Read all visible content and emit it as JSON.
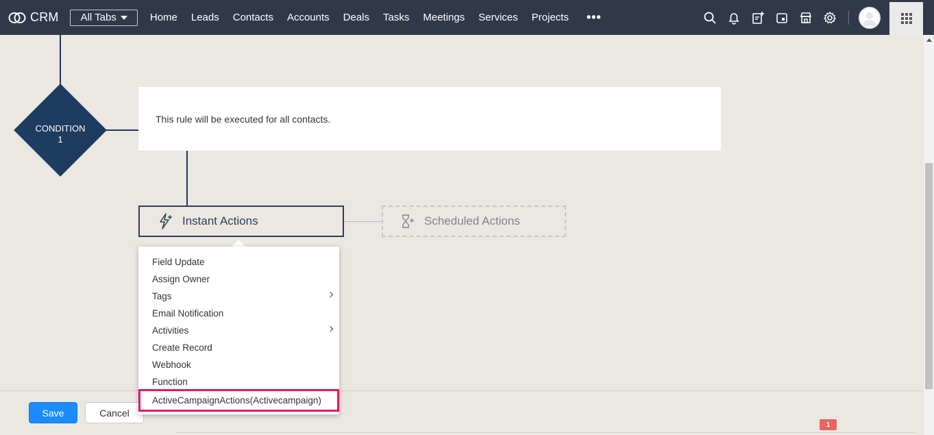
{
  "header": {
    "app_name": "CRM",
    "all_tabs_label": "All Tabs",
    "tabs": [
      "Home",
      "Leads",
      "Contacts",
      "Accounts",
      "Deals",
      "Tasks",
      "Meetings",
      "Services",
      "Projects"
    ],
    "more_label": "•••",
    "icons": [
      "search-icon",
      "bell-icon",
      "note-add-icon",
      "calendar-icon",
      "marketplace-icon",
      "gear-icon",
      "avatar",
      "apps-grid-icon"
    ]
  },
  "flow": {
    "condition_label": "CONDITION",
    "condition_number": "1",
    "rule_text": "This rule will be executed for all contacts.",
    "instant_actions_label": "Instant Actions",
    "scheduled_actions_label": "Scheduled Actions"
  },
  "menu": {
    "items": [
      {
        "label": "Field Update",
        "submenu": false
      },
      {
        "label": "Assign Owner",
        "submenu": false
      },
      {
        "label": "Tags",
        "submenu": true
      },
      {
        "label": "Email Notification",
        "submenu": false
      },
      {
        "label": "Activities",
        "submenu": true
      },
      {
        "label": "Create Record",
        "submenu": false
      },
      {
        "label": "Webhook",
        "submenu": false
      },
      {
        "label": "Function",
        "submenu": false
      }
    ],
    "highlighted_item": "ActiveCampaignActions(Activecampaign)",
    "highlight_color": "#e6175c"
  },
  "footer": {
    "save_label": "Save",
    "cancel_label": "Cancel",
    "notification_count": "1"
  },
  "colors": {
    "navbar": "#313949",
    "accent_blue": "#1a8cff",
    "node_navy": "#1e3b60"
  }
}
